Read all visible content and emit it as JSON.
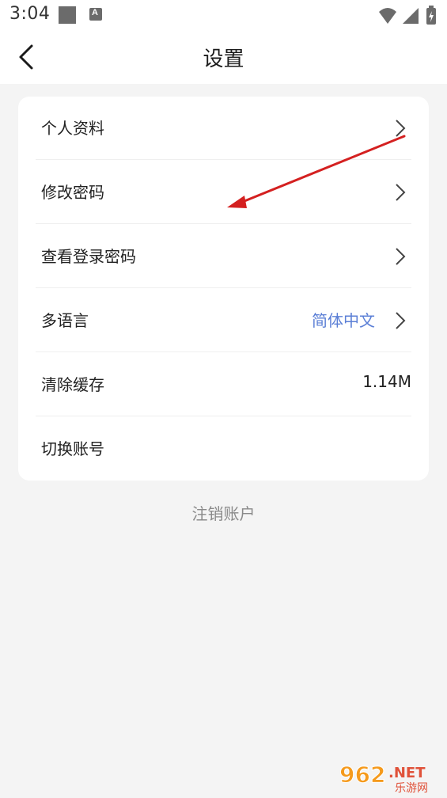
{
  "status_bar": {
    "time": "3:04",
    "a_badge": "A",
    "icons": [
      "notification-square-icon",
      "a-badge-icon",
      "wifi-icon",
      "signal-icon",
      "battery-charging-icon"
    ]
  },
  "header": {
    "title": "设置",
    "back_icon": "chevron-left-icon"
  },
  "settings": {
    "items": [
      {
        "label": "个人资料",
        "value": "",
        "has_chevron": true
      },
      {
        "label": "修改密码",
        "value": "",
        "has_chevron": true
      },
      {
        "label": "查看登录密码",
        "value": "",
        "has_chevron": true
      },
      {
        "label": "多语言",
        "value": "简体中文",
        "has_chevron": true
      },
      {
        "label": "清除缓存",
        "value": "1.14M",
        "has_chevron": false
      },
      {
        "label": "切换账号",
        "value": "",
        "has_chevron": false
      }
    ]
  },
  "logout": {
    "label": "注销账户"
  },
  "watermark": {
    "text_main": "962",
    "text_suffix": ".NET",
    "text_sub": "乐游网"
  },
  "colors": {
    "background": "#f4f4f4",
    "card": "#ffffff",
    "accent_blue": "#5b7fd6",
    "muted_text": "#8a8a8a",
    "annotation_red": "#d42020"
  }
}
